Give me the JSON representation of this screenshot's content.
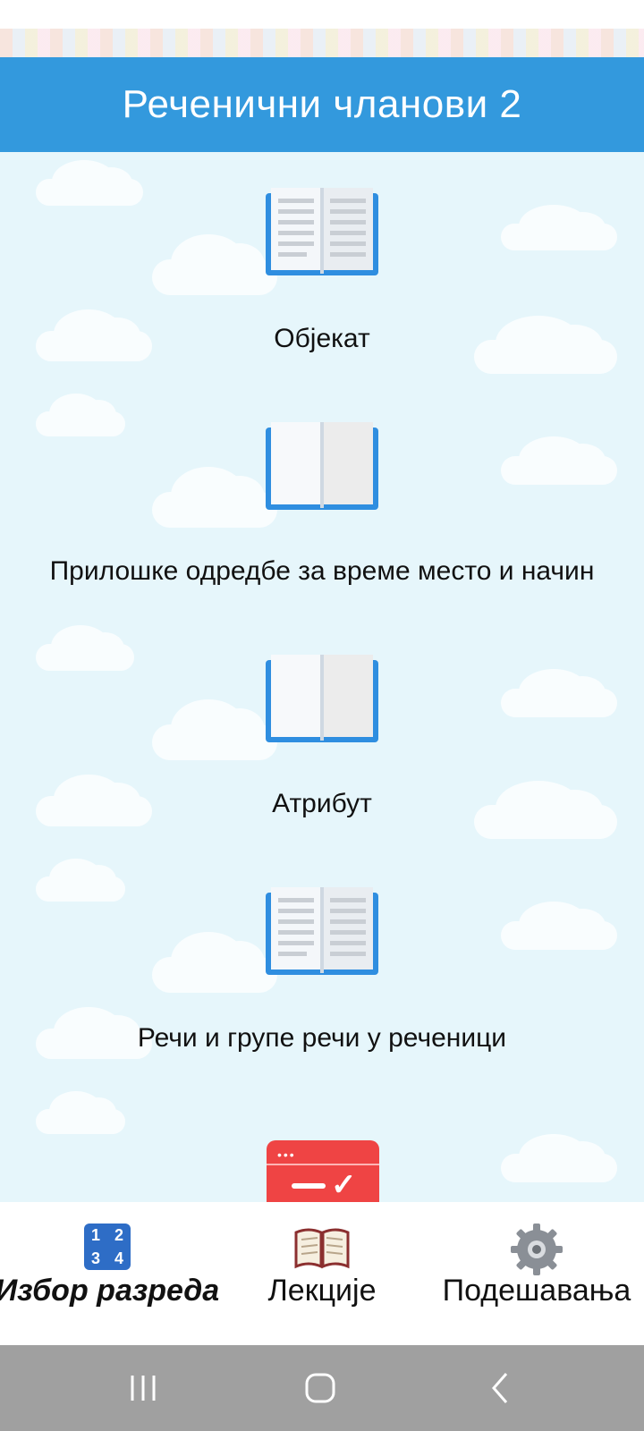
{
  "header": {
    "title": "Реченични чланови 2"
  },
  "items": [
    {
      "label": "Објекат"
    },
    {
      "label": "Прилошке одредбе за време место и начин"
    },
    {
      "label": "Атрибут"
    },
    {
      "label": "Речи и групе речи у реченици"
    }
  ],
  "bottom_nav": {
    "items": [
      {
        "label": "Избор разреда",
        "icon": "grade-numbers-icon",
        "active": true
      },
      {
        "label": "Лекције",
        "icon": "open-book-icon",
        "active": false
      },
      {
        "label": "Подешавања",
        "icon": "gear-icon",
        "active": false
      }
    ],
    "grade_digits": [
      "1",
      "2",
      "3",
      "4"
    ]
  },
  "colors": {
    "header": "#3399dd",
    "background": "#e6f6fb",
    "book_blue": "#2f8ee0",
    "quiz_red": "#ef4444",
    "system_bar": "#a0a0a0"
  }
}
